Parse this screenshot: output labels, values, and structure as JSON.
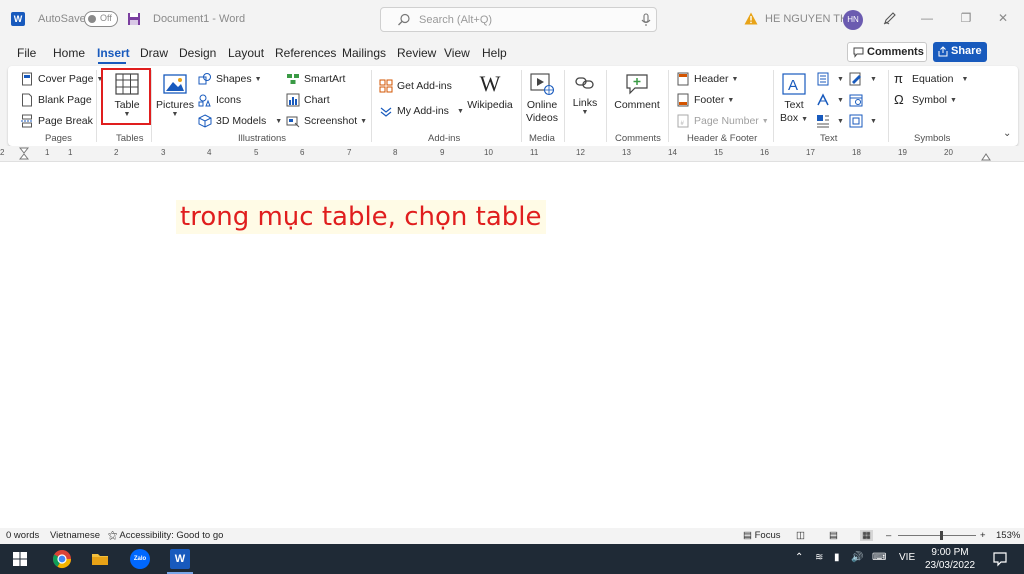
{
  "titlebar": {
    "app_letter": "W",
    "autosave_label": "AutoSave",
    "autosave_state": "Off",
    "doc_title": "Document1  -  Word",
    "search_placeholder": "Search (Alt+Q)",
    "user_name": "HE NGUYEN THE",
    "user_initials": "HN"
  },
  "menu": {
    "tabs": [
      "File",
      "Home",
      "Insert",
      "Draw",
      "Design",
      "Layout",
      "References",
      "Mailings",
      "Review",
      "View",
      "Help"
    ],
    "active_tab": "Insert",
    "comments_label": "Comments",
    "share_label": "Share"
  },
  "ribbon": {
    "pages": {
      "cover_page": "Cover Page",
      "blank_page": "Blank Page",
      "page_break": "Page Break",
      "label": "Pages"
    },
    "tables": {
      "table": "Table",
      "label": "Tables"
    },
    "illustrations": {
      "pictures": "Pictures",
      "shapes": "Shapes",
      "icons": "Icons",
      "models_3d": "3D Models",
      "smartart": "SmartArt",
      "chart": "Chart",
      "screenshot": "Screenshot",
      "label": "Illustrations"
    },
    "addins": {
      "get_addins": "Get Add-ins",
      "my_addins": "My Add-ins",
      "wikipedia": "Wikipedia",
      "label": "Add-ins"
    },
    "media": {
      "online_videos_1": "Online",
      "online_videos_2": "Videos",
      "label": "Media"
    },
    "links": {
      "links": "Links"
    },
    "comments": {
      "comment": "Comment",
      "label": "Comments"
    },
    "header_footer": {
      "header": "Header",
      "footer": "Footer",
      "page_number": "Page Number",
      "label": "Header & Footer"
    },
    "text": {
      "text_box_1": "Text",
      "text_box_2": "Box",
      "label": "Text"
    },
    "symbols": {
      "equation": "Equation",
      "symbol": "Symbol",
      "label": "Symbols"
    }
  },
  "ruler": {
    "marks": [
      "1",
      "2",
      "1",
      "2",
      "3",
      "4",
      "5",
      "6",
      "7",
      "8",
      "9",
      "10",
      "11",
      "12",
      "13",
      "14",
      "15",
      "16",
      "17",
      "18",
      "19",
      "20"
    ]
  },
  "document": {
    "annotation": "trong mục table, chọn table"
  },
  "statusbar": {
    "words": "0 words",
    "language": "Vietnamese",
    "accessibility": "Accessibility: Good to go",
    "focus": "Focus",
    "zoom": "153%"
  },
  "taskbar": {
    "zalo": "Zalo",
    "lang": "VIE",
    "time": "9:00 PM",
    "date": "23/03/2022"
  },
  "colors": {
    "word_blue": "#185abd",
    "highlight_red": "#e01e1e",
    "avatar_purple": "#6b5bb0"
  }
}
